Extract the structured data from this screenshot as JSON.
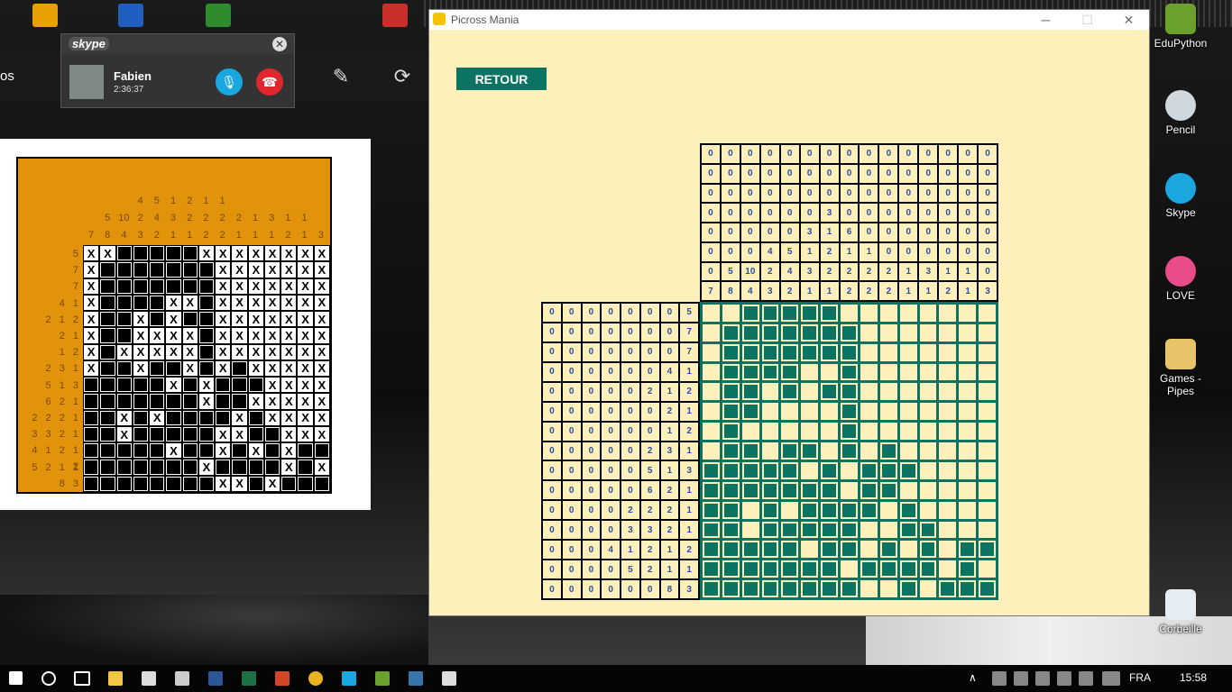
{
  "skype": {
    "brand": "skype",
    "contact": "Fabien",
    "duration": "2:36:37"
  },
  "viewer": {
    "side_text": "os"
  },
  "reference": {
    "col_clues": [
      [
        "",
        "",
        "7"
      ],
      [
        "",
        "5",
        "8"
      ],
      [
        "",
        "10",
        "4"
      ],
      [
        "4",
        "2",
        "3"
      ],
      [
        "5",
        "4",
        "2"
      ],
      [
        "1",
        "3",
        "1"
      ],
      [
        "2",
        "2",
        "1"
      ],
      [
        "1",
        "2",
        "2"
      ],
      [
        "1",
        "2",
        "2"
      ],
      [
        "",
        "2",
        "1"
      ],
      [
        "",
        "1",
        "1"
      ],
      [
        "",
        "3",
        "1"
      ],
      [
        "",
        "1",
        "2"
      ],
      [
        "",
        "1",
        "1"
      ],
      [
        "",
        "",
        "3"
      ]
    ],
    "col_top": [
      [
        "",
        "3",
        ""
      ],
      [
        "3",
        "1",
        "6"
      ]
    ],
    "row_clues": [
      "5",
      "7",
      "7",
      "4 1",
      "2 1 2",
      "2 1",
      "1 2",
      "2 3 1",
      "5 1 3",
      "6 2 1",
      "2 2 2 1",
      "3 3 2 1",
      "4 1 2 1 2",
      "5 2 1 1",
      "8 3"
    ]
  },
  "picross": {
    "window_title": "Picross Mania",
    "retour_label": "RETOUR",
    "col_clues": [
      [
        "0",
        "0",
        "0",
        "0",
        "0",
        "0",
        "0",
        "0",
        "0",
        "0",
        "0",
        "0",
        "0",
        "0",
        "0"
      ],
      [
        "0",
        "0",
        "0",
        "0",
        "0",
        "0",
        "0",
        "0",
        "0",
        "0",
        "0",
        "0",
        "0",
        "0",
        "0"
      ],
      [
        "0",
        "0",
        "0",
        "0",
        "0",
        "0",
        "0",
        "0",
        "0",
        "0",
        "0",
        "0",
        "0",
        "0",
        "0"
      ],
      [
        "0",
        "0",
        "0",
        "0",
        "0",
        "0",
        "3",
        "0",
        "0",
        "0",
        "0",
        "0",
        "0",
        "0",
        "0"
      ],
      [
        "0",
        "0",
        "0",
        "0",
        "0",
        "3",
        "1",
        "6",
        "0",
        "0",
        "0",
        "0",
        "0",
        "0",
        "0"
      ],
      [
        "0",
        "0",
        "0",
        "4",
        "5",
        "1",
        "2",
        "1",
        "1",
        "0",
        "0",
        "0",
        "0",
        "0",
        "0"
      ],
      [
        "0",
        "5",
        "10",
        "2",
        "4",
        "3",
        "2",
        "2",
        "2",
        "2",
        "1",
        "3",
        "1",
        "1",
        "0"
      ],
      [
        "7",
        "8",
        "4",
        "3",
        "2",
        "1",
        "1",
        "2",
        "2",
        "2",
        "1",
        "1",
        "2",
        "1",
        "3"
      ]
    ],
    "row_clues": [
      [
        "0",
        "0",
        "0",
        "0",
        "0",
        "0",
        "0",
        "5"
      ],
      [
        "0",
        "0",
        "0",
        "0",
        "0",
        "0",
        "0",
        "7"
      ],
      [
        "0",
        "0",
        "0",
        "0",
        "0",
        "0",
        "0",
        "7"
      ],
      [
        "0",
        "0",
        "0",
        "0",
        "0",
        "0",
        "4",
        "1"
      ],
      [
        "0",
        "0",
        "0",
        "0",
        "0",
        "2",
        "1",
        "2"
      ],
      [
        "0",
        "0",
        "0",
        "0",
        "0",
        "0",
        "2",
        "1"
      ],
      [
        "0",
        "0",
        "0",
        "0",
        "0",
        "0",
        "1",
        "2"
      ],
      [
        "0",
        "0",
        "0",
        "0",
        "0",
        "2",
        "3",
        "1"
      ],
      [
        "0",
        "0",
        "0",
        "0",
        "0",
        "5",
        "1",
        "3"
      ],
      [
        "0",
        "0",
        "0",
        "0",
        "0",
        "6",
        "2",
        "1"
      ],
      [
        "0",
        "0",
        "0",
        "0",
        "2",
        "2",
        "2",
        "1"
      ],
      [
        "0",
        "0",
        "0",
        "0",
        "3",
        "3",
        "2",
        "1"
      ],
      [
        "0",
        "0",
        "0",
        "4",
        "1",
        "2",
        "1",
        "2"
      ],
      [
        "0",
        "0",
        "0",
        "0",
        "5",
        "2",
        "1",
        "1"
      ],
      [
        "0",
        "0",
        "0",
        "0",
        "0",
        "0",
        "8",
        "3"
      ]
    ],
    "grid": [
      "..11111........",
      ".1111111.......",
      ".1111111.......",
      ".1111..1.......",
      ".11.1.11.......",
      ".11....1.......",
      ".1.....1.......",
      ".11.11.1.1.....",
      "11111.1.111....",
      "1111111.11.....",
      "11.1.1111.1....",
      "11.11111..11...",
      "11111.11.1.1.11",
      "1111111.1111.1.",
      "11111111..1.111"
    ]
  },
  "desktop_icons": [
    {
      "label": "EduPython"
    },
    {
      "label": "Pencil"
    },
    {
      "label": "Skype"
    },
    {
      "label": "LOVE"
    },
    {
      "label": "Games - Pipes"
    },
    {
      "label": "Corbeille"
    }
  ],
  "taskbar": {
    "lang": "FRA",
    "time": "15:58"
  }
}
